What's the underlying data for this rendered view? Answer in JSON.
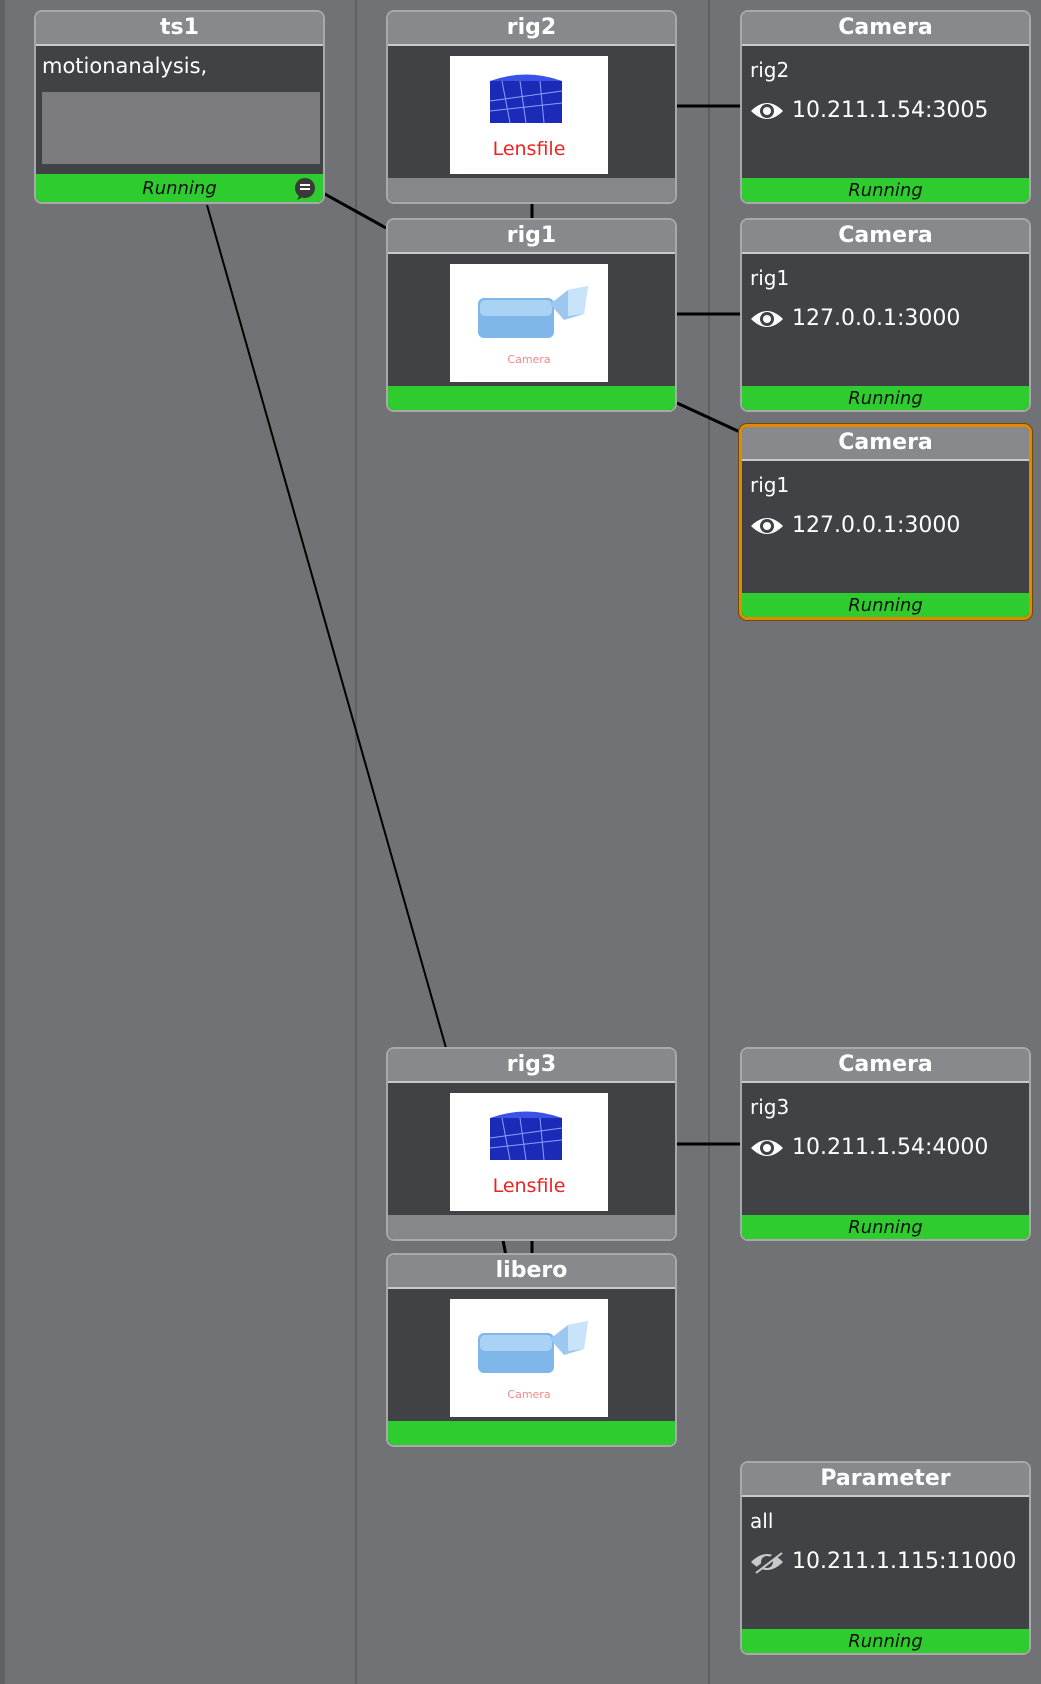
{
  "nodes": {
    "ts1": {
      "title": "ts1",
      "text": "motionanalysis,",
      "status": "Running"
    },
    "rig2": {
      "title": "rig2",
      "thumb_label": "Lensfile"
    },
    "rig1": {
      "title": "rig1",
      "thumb_label": "Camera"
    },
    "rig3": {
      "title": "rig3",
      "thumb_label": "Lensfile"
    },
    "libero": {
      "title": "libero",
      "thumb_label": "Camera"
    },
    "camera_rig2": {
      "title": "Camera",
      "label": "rig2",
      "address": "10.211.1.54:3005",
      "status": "Running"
    },
    "camera_rig1_a": {
      "title": "Camera",
      "label": "rig1",
      "address": "127.0.0.1:3000",
      "status": "Running"
    },
    "camera_rig1_b": {
      "title": "Camera",
      "label": "rig1",
      "address": "127.0.0.1:3000",
      "status": "Running"
    },
    "camera_rig3": {
      "title": "Camera",
      "label": "rig3",
      "address": "10.211.1.54:4000",
      "status": "Running"
    },
    "parameter_all": {
      "title": "Parameter",
      "label": "all",
      "address": "10.211.1.115:11000",
      "status": "Running"
    }
  },
  "icons": {
    "eye": "eye-icon",
    "eye_hidden": "eye-slash-icon",
    "comment": "comment-icon"
  },
  "colors": {
    "running_green": "#2ecc2e",
    "selected_border": "#e08a00"
  }
}
